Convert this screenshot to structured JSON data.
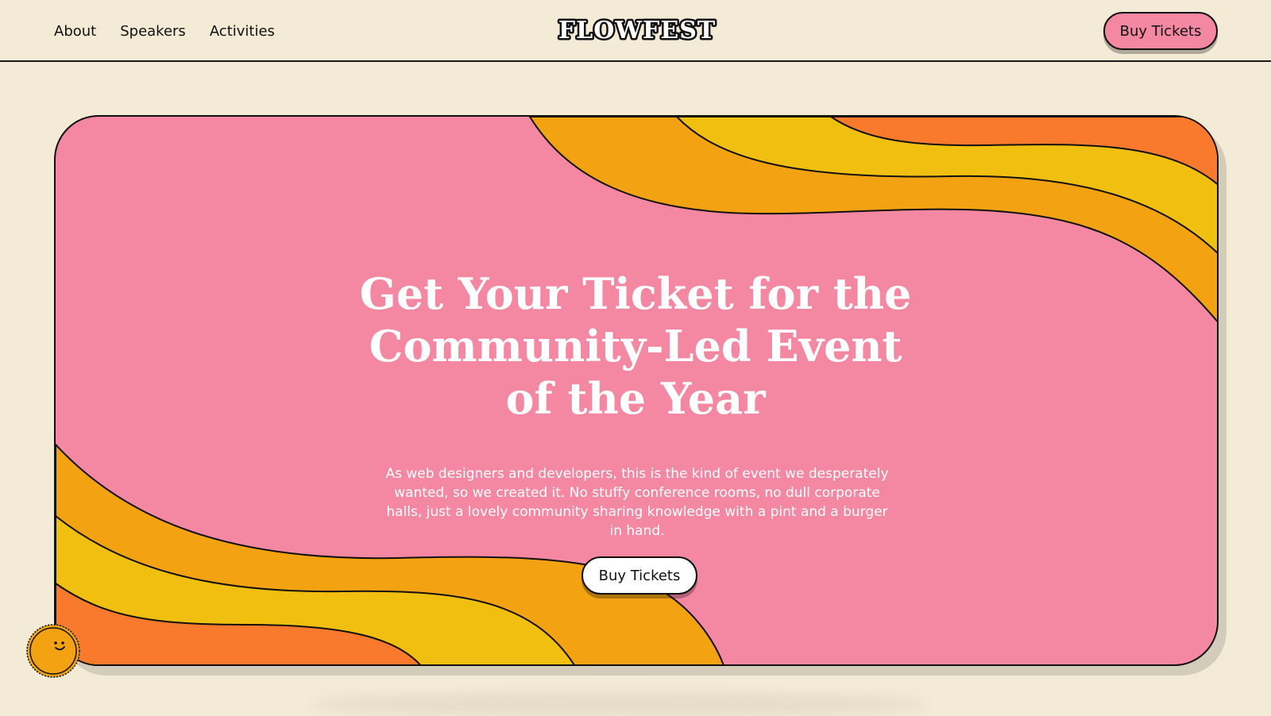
{
  "nav": {
    "items": [
      {
        "label": "About"
      },
      {
        "label": "Speakers"
      },
      {
        "label": "Activities"
      }
    ]
  },
  "brand": {
    "logo_text": "FLOWFEST"
  },
  "header": {
    "cta_label": "Buy Tickets"
  },
  "hero": {
    "title": "Get Your Ticket for the Community-Led Event of the Year",
    "description": "As web designers and developers, this is the kind of event we desperately wanted, so we created it. No stuffy conference rooms, no dull corporate halls, just a lovely community sharing knowledge with a pint and a burger in hand.",
    "cta_label": "Buy Tickets"
  },
  "colors": {
    "background": "#f4ebd6",
    "pink": "#f487a2",
    "orange_dark": "#f97a2d",
    "orange": "#f3a312",
    "yellow": "#f0bf0f",
    "outline": "#111111",
    "text_white": "#ffffff"
  },
  "icons": {
    "sun": "smiling-sun-icon"
  }
}
